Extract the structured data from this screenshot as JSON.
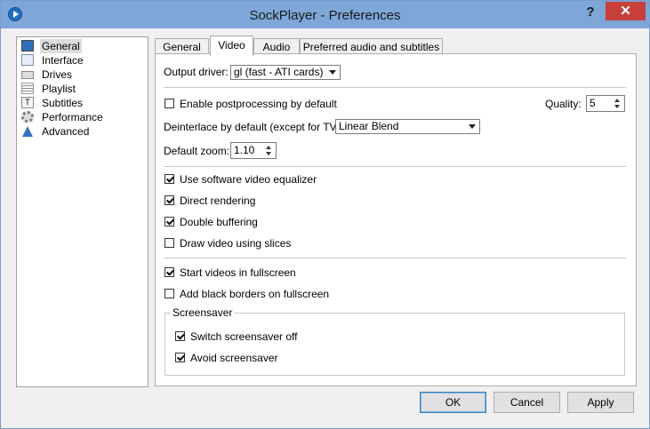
{
  "window": {
    "title": "SockPlayer - Preferences",
    "help_label": "?",
    "close_label": "✕"
  },
  "sidebar": {
    "items": [
      {
        "label": "General",
        "icon": "monitor-icon",
        "selected": true
      },
      {
        "label": "Interface",
        "icon": "interface-icon"
      },
      {
        "label": "Drives",
        "icon": "drive-icon"
      },
      {
        "label": "Playlist",
        "icon": "playlist-icon"
      },
      {
        "label": "Subtitles",
        "icon": "subtitles-icon"
      },
      {
        "label": "Performance",
        "icon": "gear-icon"
      },
      {
        "label": "Advanced",
        "icon": "flask-icon"
      }
    ]
  },
  "tabs": [
    {
      "label": "General"
    },
    {
      "label": "Video",
      "active": true
    },
    {
      "label": "Audio"
    },
    {
      "label": "Preferred audio and subtitles"
    }
  ],
  "video": {
    "output_driver_label": "Output driver:",
    "output_driver_value": "gl (fast - ATI cards)",
    "postprocessing_label": "Enable postprocessing by default",
    "postprocessing_checked": false,
    "quality_label": "Quality:",
    "quality_value": "5",
    "deinterlace_label": "Deinterlace by default (except for TV):",
    "deinterlace_value": "Linear Blend",
    "zoom_label": "Default zoom:",
    "zoom_value": "1.10",
    "equalizer_label": "Use software video equalizer",
    "direct_rendering_label": "Direct rendering",
    "double_buffering_label": "Double buffering",
    "slices_label": "Draw video using slices",
    "fullscreen_label": "Start videos in fullscreen",
    "black_borders_label": "Add black borders on fullscreen",
    "screensaver": {
      "group_title": "Screensaver",
      "switch_off_label": "Switch screensaver off",
      "avoid_label": "Avoid screensaver"
    }
  },
  "buttons": {
    "ok": "OK",
    "cancel": "Cancel",
    "apply": "Apply"
  },
  "colors": {
    "titlebar": "#7ea6d8",
    "close": "#c7403a"
  }
}
